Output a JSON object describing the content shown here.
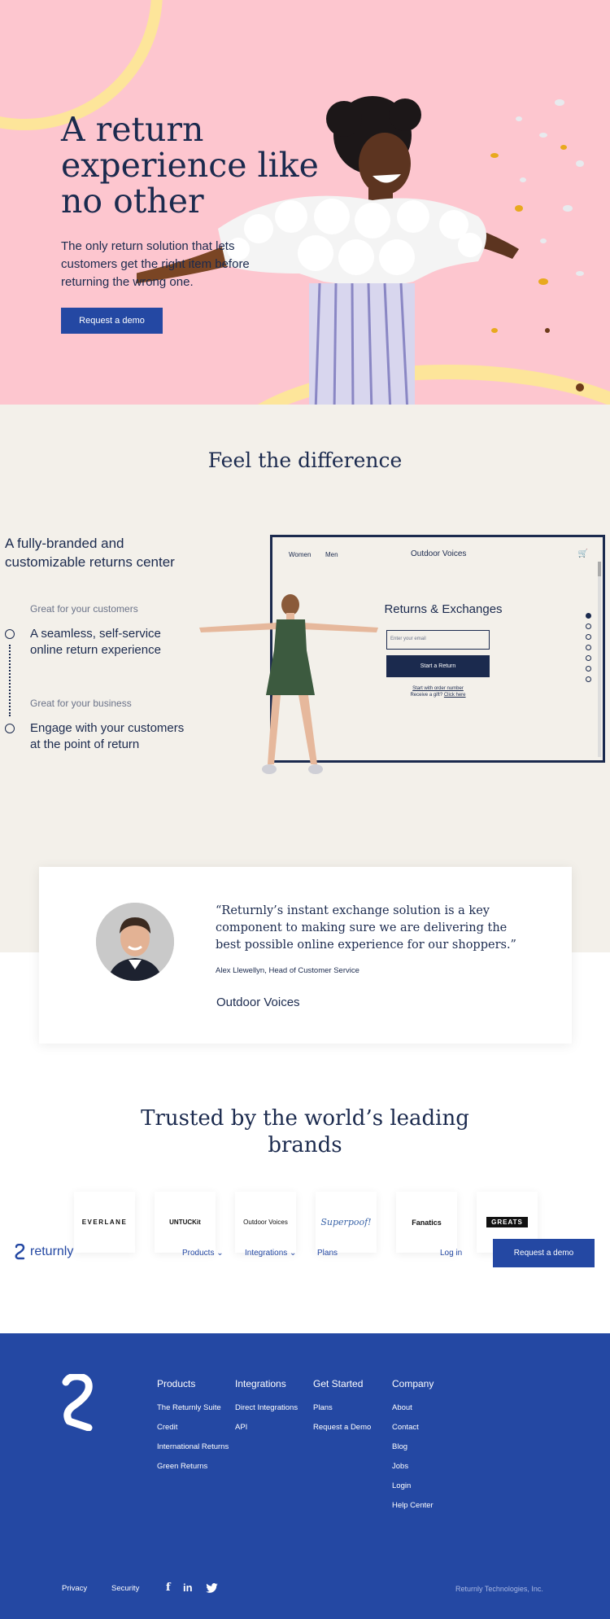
{
  "hero": {
    "title": "A return experience like no other",
    "subtitle": "The only return solution that lets customers get the right item before returning the wrong one.",
    "cta": "Request a demo",
    "colors": {
      "background": "#fdc6cf",
      "accent_arc": "#fde59a"
    }
  },
  "feel": {
    "heading": "Feel the difference",
    "lead": "A fully-branded and customizable returns center",
    "steps": [
      {
        "kicker": "Great for your customers",
        "text": "A seamless, self-service online return experience"
      },
      {
        "kicker": "Great for your business",
        "text": "Engage with your customers at the point of return"
      }
    ],
    "demo": {
      "nav_women": "Women",
      "nav_men": "Men",
      "brand": "Outdoor Voices",
      "title": "Returns & Exchanges",
      "email_placeholder": "Enter your email",
      "start_button": "Start a Return",
      "order_link": "Start with order number",
      "gift_text": "Receive a gift?",
      "gift_link": "Click here"
    }
  },
  "testimonial": {
    "quote": "“Returnly’s instant exchange solution is a key component to making sure we are delivering the best possible online experience for our shoppers.”",
    "author": "Alex Llewellyn, Head of Customer Service",
    "company_logo": "Outdoor Voices"
  },
  "trusted": {
    "heading": "Trusted by the world’s leading brands",
    "brands": [
      "EVERLANE",
      "UNTUCKit",
      "Outdoor Voices",
      "Superpoof!",
      "Fanatics",
      "GREATS"
    ]
  },
  "nav": {
    "logo": "returnly",
    "products": "Products",
    "integrations": "Integrations",
    "plans": "Plans",
    "login": "Log in",
    "cta": "Request a demo"
  },
  "footer": {
    "columns": [
      {
        "heading": "Products",
        "items": [
          "The Returnly Suite",
          "Credit",
          "International Returns",
          "Green Returns"
        ]
      },
      {
        "heading": "Integrations",
        "items": [
          "Direct Integrations",
          "API"
        ]
      },
      {
        "heading": "Get Started",
        "items": [
          "Plans",
          "Request a Demo"
        ]
      },
      {
        "heading": "Company",
        "items": [
          "About",
          "Contact",
          "Blog",
          "Jobs",
          "Login",
          "Help Center"
        ]
      }
    ],
    "privacy": "Privacy",
    "security": "Security",
    "social": [
      "facebook-icon",
      "linkedin-icon",
      "twitter-icon"
    ],
    "copyright": "Returnly Technologies, Inc.",
    "color": "#2448a3"
  }
}
